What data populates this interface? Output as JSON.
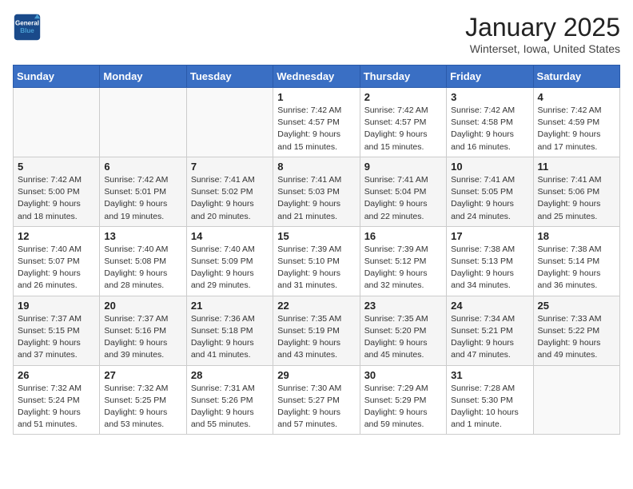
{
  "logo": {
    "line1": "General",
    "line2": "Blue"
  },
  "title": "January 2025",
  "subtitle": "Winterset, Iowa, United States",
  "days_of_week": [
    "Sunday",
    "Monday",
    "Tuesday",
    "Wednesday",
    "Thursday",
    "Friday",
    "Saturday"
  ],
  "weeks": [
    [
      {
        "day": "",
        "content": ""
      },
      {
        "day": "",
        "content": ""
      },
      {
        "day": "",
        "content": ""
      },
      {
        "day": "1",
        "content": "Sunrise: 7:42 AM\nSunset: 4:57 PM\nDaylight: 9 hours\nand 15 minutes."
      },
      {
        "day": "2",
        "content": "Sunrise: 7:42 AM\nSunset: 4:57 PM\nDaylight: 9 hours\nand 15 minutes."
      },
      {
        "day": "3",
        "content": "Sunrise: 7:42 AM\nSunset: 4:58 PM\nDaylight: 9 hours\nand 16 minutes."
      },
      {
        "day": "4",
        "content": "Sunrise: 7:42 AM\nSunset: 4:59 PM\nDaylight: 9 hours\nand 17 minutes."
      }
    ],
    [
      {
        "day": "5",
        "content": "Sunrise: 7:42 AM\nSunset: 5:00 PM\nDaylight: 9 hours\nand 18 minutes."
      },
      {
        "day": "6",
        "content": "Sunrise: 7:42 AM\nSunset: 5:01 PM\nDaylight: 9 hours\nand 19 minutes."
      },
      {
        "day": "7",
        "content": "Sunrise: 7:41 AM\nSunset: 5:02 PM\nDaylight: 9 hours\nand 20 minutes."
      },
      {
        "day": "8",
        "content": "Sunrise: 7:41 AM\nSunset: 5:03 PM\nDaylight: 9 hours\nand 21 minutes."
      },
      {
        "day": "9",
        "content": "Sunrise: 7:41 AM\nSunset: 5:04 PM\nDaylight: 9 hours\nand 22 minutes."
      },
      {
        "day": "10",
        "content": "Sunrise: 7:41 AM\nSunset: 5:05 PM\nDaylight: 9 hours\nand 24 minutes."
      },
      {
        "day": "11",
        "content": "Sunrise: 7:41 AM\nSunset: 5:06 PM\nDaylight: 9 hours\nand 25 minutes."
      }
    ],
    [
      {
        "day": "12",
        "content": "Sunrise: 7:40 AM\nSunset: 5:07 PM\nDaylight: 9 hours\nand 26 minutes."
      },
      {
        "day": "13",
        "content": "Sunrise: 7:40 AM\nSunset: 5:08 PM\nDaylight: 9 hours\nand 28 minutes."
      },
      {
        "day": "14",
        "content": "Sunrise: 7:40 AM\nSunset: 5:09 PM\nDaylight: 9 hours\nand 29 minutes."
      },
      {
        "day": "15",
        "content": "Sunrise: 7:39 AM\nSunset: 5:10 PM\nDaylight: 9 hours\nand 31 minutes."
      },
      {
        "day": "16",
        "content": "Sunrise: 7:39 AM\nSunset: 5:12 PM\nDaylight: 9 hours\nand 32 minutes."
      },
      {
        "day": "17",
        "content": "Sunrise: 7:38 AM\nSunset: 5:13 PM\nDaylight: 9 hours\nand 34 minutes."
      },
      {
        "day": "18",
        "content": "Sunrise: 7:38 AM\nSunset: 5:14 PM\nDaylight: 9 hours\nand 36 minutes."
      }
    ],
    [
      {
        "day": "19",
        "content": "Sunrise: 7:37 AM\nSunset: 5:15 PM\nDaylight: 9 hours\nand 37 minutes."
      },
      {
        "day": "20",
        "content": "Sunrise: 7:37 AM\nSunset: 5:16 PM\nDaylight: 9 hours\nand 39 minutes."
      },
      {
        "day": "21",
        "content": "Sunrise: 7:36 AM\nSunset: 5:18 PM\nDaylight: 9 hours\nand 41 minutes."
      },
      {
        "day": "22",
        "content": "Sunrise: 7:35 AM\nSunset: 5:19 PM\nDaylight: 9 hours\nand 43 minutes."
      },
      {
        "day": "23",
        "content": "Sunrise: 7:35 AM\nSunset: 5:20 PM\nDaylight: 9 hours\nand 45 minutes."
      },
      {
        "day": "24",
        "content": "Sunrise: 7:34 AM\nSunset: 5:21 PM\nDaylight: 9 hours\nand 47 minutes."
      },
      {
        "day": "25",
        "content": "Sunrise: 7:33 AM\nSunset: 5:22 PM\nDaylight: 9 hours\nand 49 minutes."
      }
    ],
    [
      {
        "day": "26",
        "content": "Sunrise: 7:32 AM\nSunset: 5:24 PM\nDaylight: 9 hours\nand 51 minutes."
      },
      {
        "day": "27",
        "content": "Sunrise: 7:32 AM\nSunset: 5:25 PM\nDaylight: 9 hours\nand 53 minutes."
      },
      {
        "day": "28",
        "content": "Sunrise: 7:31 AM\nSunset: 5:26 PM\nDaylight: 9 hours\nand 55 minutes."
      },
      {
        "day": "29",
        "content": "Sunrise: 7:30 AM\nSunset: 5:27 PM\nDaylight: 9 hours\nand 57 minutes."
      },
      {
        "day": "30",
        "content": "Sunrise: 7:29 AM\nSunset: 5:29 PM\nDaylight: 9 hours\nand 59 minutes."
      },
      {
        "day": "31",
        "content": "Sunrise: 7:28 AM\nSunset: 5:30 PM\nDaylight: 10 hours\nand 1 minute."
      },
      {
        "day": "",
        "content": ""
      }
    ]
  ]
}
